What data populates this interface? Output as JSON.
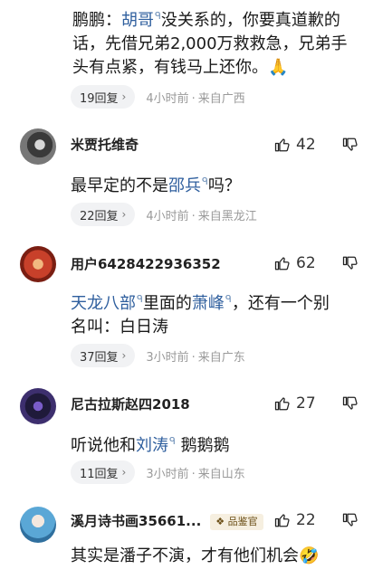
{
  "top_comment": {
    "prefix": "鹏鹏：",
    "topic": "胡哥",
    "line1_rest": "没关系的，你要真道歉的",
    "line2": "话，先借兄弟2,000万救救急，兄弟手",
    "line3": "头有点紧，有钱马上还你。",
    "emoji": "🙏",
    "replies": "19回复",
    "time": "4小时前",
    "location": "来自广西"
  },
  "comments": [
    {
      "user": "米贾托维奇",
      "likes": "42",
      "text_pre": "最早定的不是",
      "topic": "邵兵",
      "text_post": "吗？",
      "replies": "22回复",
      "time": "4小时前",
      "location": "来自黑龙江"
    },
    {
      "user": "用户6428422936352",
      "likes": "62",
      "topic1": "天龙八部",
      "mid": "里面的",
      "topic2": "萧峰",
      "line1_end": "，还有一个别",
      "line2": "名叫：白日涛",
      "replies": "37回复",
      "time": "3小时前",
      "location": "来自广东"
    },
    {
      "user": "尼古拉斯赵四2018",
      "likes": "27",
      "text_pre": "听说他和",
      "topic": "刘涛",
      "text_post": "鹅鹅鹅",
      "replies": "11回复",
      "time": "3小时前",
      "location": "来自山东"
    },
    {
      "user": "溪月诗书画35661...",
      "badge": "品鉴官",
      "likes": "22",
      "text": "其实是潘子不演，才有他们机会",
      "emoji": "🤣"
    }
  ],
  "icons": {
    "search_marker": "ᑫ",
    "like": "thumb-up-icon",
    "dislike": "thumb-down-icon",
    "chevron": "›"
  }
}
